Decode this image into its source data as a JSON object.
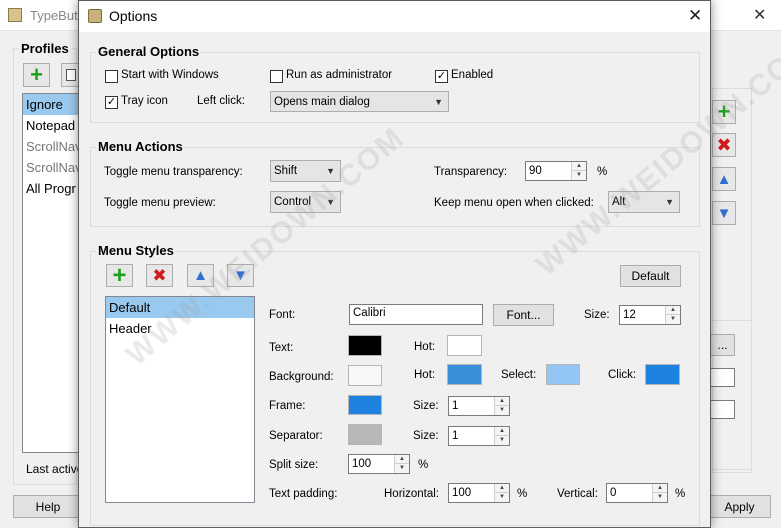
{
  "bg_window": {
    "title": "TypeBut",
    "profiles_label": "Profiles",
    "profiles": [
      "Ignore",
      "Notepad",
      "ScrollNav",
      "ScrollNav",
      "All Progr"
    ],
    "last_active": "Last active",
    "help_button": "Help",
    "apply_button": "Apply",
    "side_button": "..."
  },
  "dialog": {
    "title": "Options",
    "close_glyph": "✕",
    "general": {
      "title": "General Options",
      "start_with_windows": "Start with Windows",
      "run_as_admin": "Run as administrator",
      "enabled": "Enabled",
      "tray_icon": "Tray icon",
      "left_click_label": "Left click:",
      "left_click_value": "Opens main dialog",
      "checked_mark": "✓"
    },
    "menu_actions": {
      "title": "Menu Actions",
      "toggle_transparency_label": "Toggle menu transparency:",
      "toggle_transparency_value": "Shift",
      "toggle_preview_label": "Toggle menu preview:",
      "toggle_preview_value": "Control",
      "transparency_label": "Transparency:",
      "transparency_value": "90",
      "transparency_unit": "%",
      "keep_open_label": "Keep menu open when clicked:",
      "keep_open_value": "Alt"
    },
    "menu_styles": {
      "title": "Menu Styles",
      "default_button": "Default",
      "styles": [
        "Default",
        "Header"
      ],
      "font_label": "Font:",
      "font_value": "Calibri",
      "font_button": "Font...",
      "size_label": "Size:",
      "size_value": "12",
      "text_label": "Text:",
      "hot_label": "Hot:",
      "background_label": "Background:",
      "select_label": "Select:",
      "click_label": "Click:",
      "frame_label": "Frame:",
      "frame_size_value": "1",
      "separator_label": "Separator:",
      "separator_size_value": "1",
      "split_size_label": "Split size:",
      "split_size_value": "100",
      "percent": "%",
      "text_padding_label": "Text padding:",
      "horizontal_label": "Horizontal:",
      "horizontal_value": "100",
      "vertical_label": "Vertical:",
      "vertical_value": "0"
    },
    "colors": {
      "text": "#000000",
      "text_hot": "#ffffff",
      "background": "#f7f7f7",
      "background_hot": "#3a8fdb",
      "select": "#93c5f5",
      "click": "#1e82e0",
      "frame": "#1e82e0",
      "separator": "#b8b8b8"
    }
  },
  "watermark": "WWW.WEIDOWN.COM"
}
